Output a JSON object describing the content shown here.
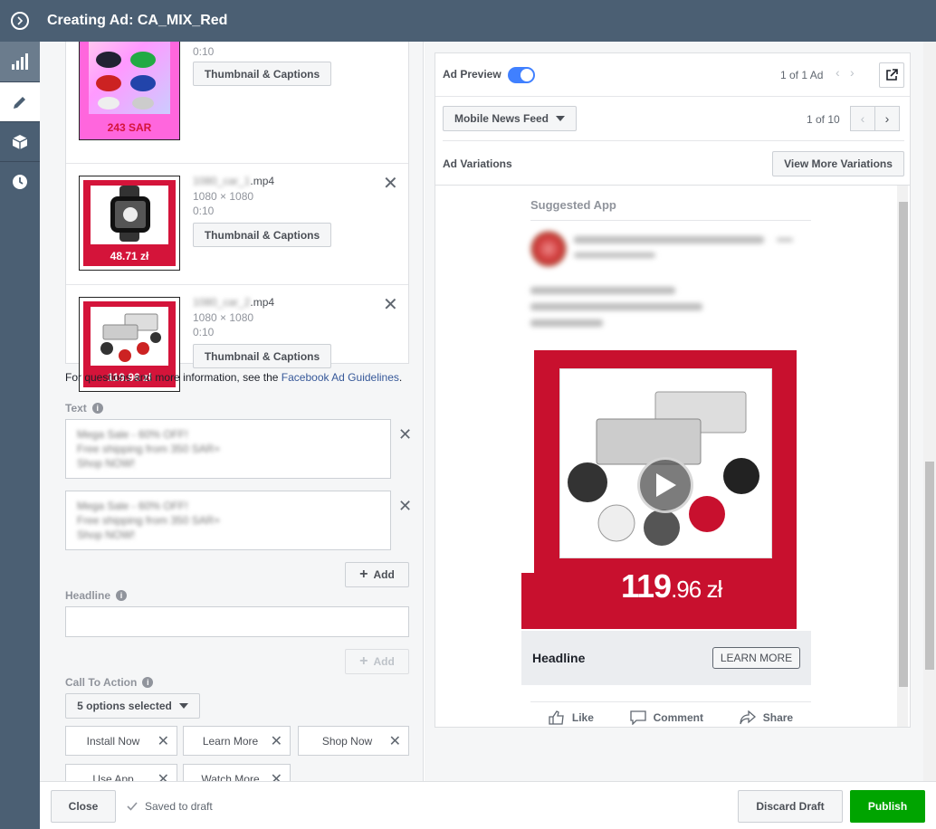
{
  "window": {
    "title": "Creating Ad: CA_MIX_Red"
  },
  "sidebar": {
    "items": [
      {
        "icon": "bar-chart-icon"
      },
      {
        "icon": "pencil-icon"
      },
      {
        "icon": "box-icon"
      },
      {
        "icon": "clock-icon"
      }
    ]
  },
  "videos": [
    {
      "name_blurred": "",
      "ext": "",
      "dims": "",
      "duration": "0:10",
      "button": "Thumbnail & Captions",
      "price": "243 SAR"
    },
    {
      "name_blurred": "1080_car_1",
      "ext": ".mp4",
      "dims": "1080 × 1080",
      "duration": "0:10",
      "button": "Thumbnail & Captions",
      "price": "48.71 zł"
    },
    {
      "name_blurred": "1080_car_2",
      "ext": ".mp4",
      "dims": "1080 × 1080",
      "duration": "0:10",
      "button": "Thumbnail & Captions",
      "price": "119.96 zł"
    }
  ],
  "guidelines": {
    "prefix": "For questions and more information, see the ",
    "link": "Facebook Ad Guidelines",
    "suffix": "."
  },
  "text_section": {
    "label": "Text",
    "entries": [
      [
        "Mega Sale - 60% OFF!",
        "Free shipping from 350 SAR+",
        "Shop NOW!"
      ],
      [
        "Mega Sale - 60% OFF!",
        "Free shipping from 350 SAR+",
        "Shop NOW!"
      ]
    ],
    "add_label": "Add"
  },
  "headline_section": {
    "label": "Headline",
    "value": "",
    "add_label": "Add"
  },
  "cta_section": {
    "label": "Call To Action",
    "selected": "5 options selected",
    "options": [
      "Install Now",
      "Learn More",
      "Shop Now",
      "Use App",
      "Watch More"
    ]
  },
  "preview": {
    "label": "Ad Preview",
    "toggle_on": true,
    "count": "1 of 1 Ad",
    "placement": "Mobile News Feed",
    "placement_count": "1 of 10",
    "variations_label": "Ad Variations",
    "variations_button": "View More Variations",
    "feed": {
      "suggested": "Suggested App",
      "price_main": "119",
      "price_dec": ".96 zł",
      "headline": "Headline",
      "cta": "LEARN MORE",
      "actions": [
        "Like",
        "Comment",
        "Share"
      ]
    }
  },
  "footer": {
    "close": "Close",
    "saved": "Saved to draft",
    "discard": "Discard Draft",
    "publish": "Publish"
  },
  "colors": {
    "header": "#4b5f73",
    "accent": "#4080ff",
    "publish": "#00a400",
    "link": "#365899",
    "brand_red": "#c8102e"
  }
}
